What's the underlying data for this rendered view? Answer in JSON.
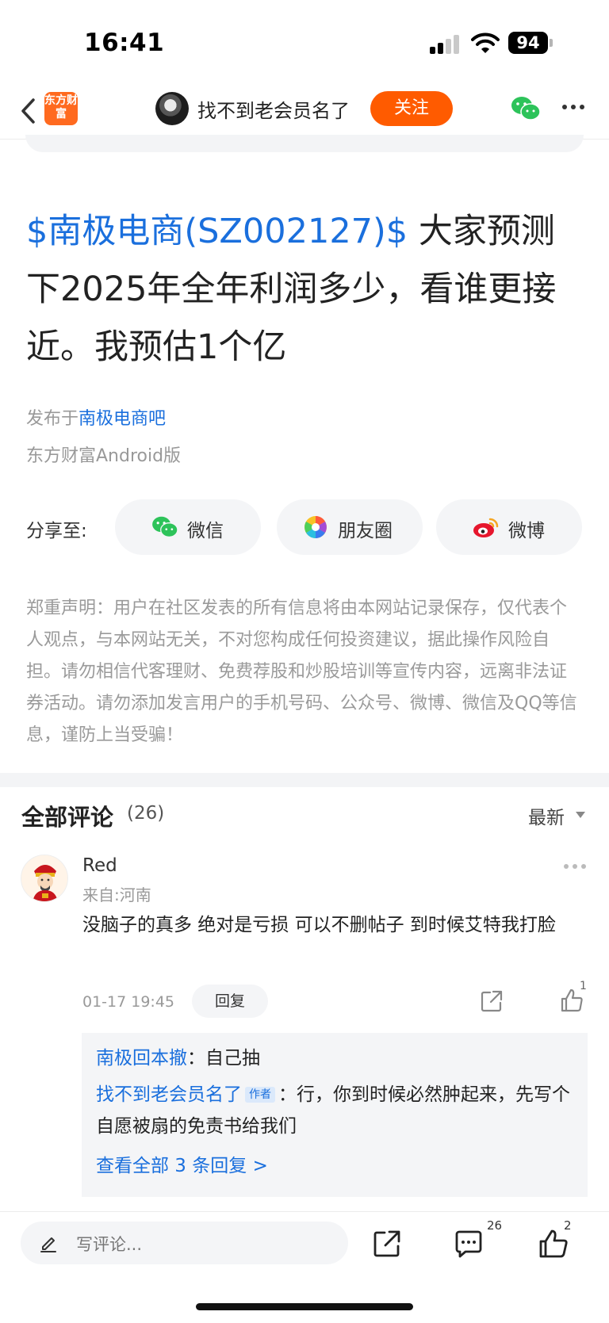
{
  "status_bar": {
    "time": "16:41",
    "battery": "94"
  },
  "nav": {
    "app_logo": "东方财富",
    "author_name": "找不到老会员名了",
    "follow_label": "关注"
  },
  "post": {
    "stock_tag": "$南极电商(SZ002127)$",
    "title_text": "  大家预测下2025年全年利润多少，看谁更接近。我预估1个亿",
    "published_prefix": "发布于",
    "forum_name": "南极电商吧",
    "client": "东方财富Android版"
  },
  "share": {
    "label": "分享至:",
    "targets": [
      {
        "label": "微信",
        "icon": "wechat-icon"
      },
      {
        "label": "朋友圈",
        "icon": "moments-icon"
      },
      {
        "label": "微博",
        "icon": "weibo-icon"
      }
    ]
  },
  "disclaimer": "郑重声明：用户在社区发表的所有信息将由本网站记录保存，仅代表个人观点，与本网站无关，不对您构成任何投资建议，据此操作风险自担。请勿相信代客理财、免费荐股和炒股培训等宣传内容，远离非法证券活动。请勿添加发言用户的手机号码、公众号、微博、微信及QQ等信息，谨防上当受骗！",
  "comments": {
    "title": "全部评论",
    "count": "(26)",
    "sort": "最新",
    "items": [
      {
        "user": "Red",
        "location": "来自:河南",
        "text": "没脑子的真多   绝对是亏损  可以不删帖子  到时候艾特我打脸",
        "time": "01-17 19:45",
        "reply_label": "回复",
        "likes": "1",
        "replies": [
          {
            "name": "南极回本撤",
            "text": "自己抽"
          },
          {
            "name": "找不到老会员名了",
            "tag": "作者",
            "text": "行，你到时候必然肿起来，先写个自愿被扇的免责书给我们"
          }
        ],
        "view_all": "查看全部 3 条回复 >"
      }
    ]
  },
  "bottom_bar": {
    "input_placeholder": "写评论...",
    "comment_count": "26",
    "like_count": "2"
  },
  "colors": {
    "accent": "#ff5b00",
    "link": "#1a6fdd"
  }
}
